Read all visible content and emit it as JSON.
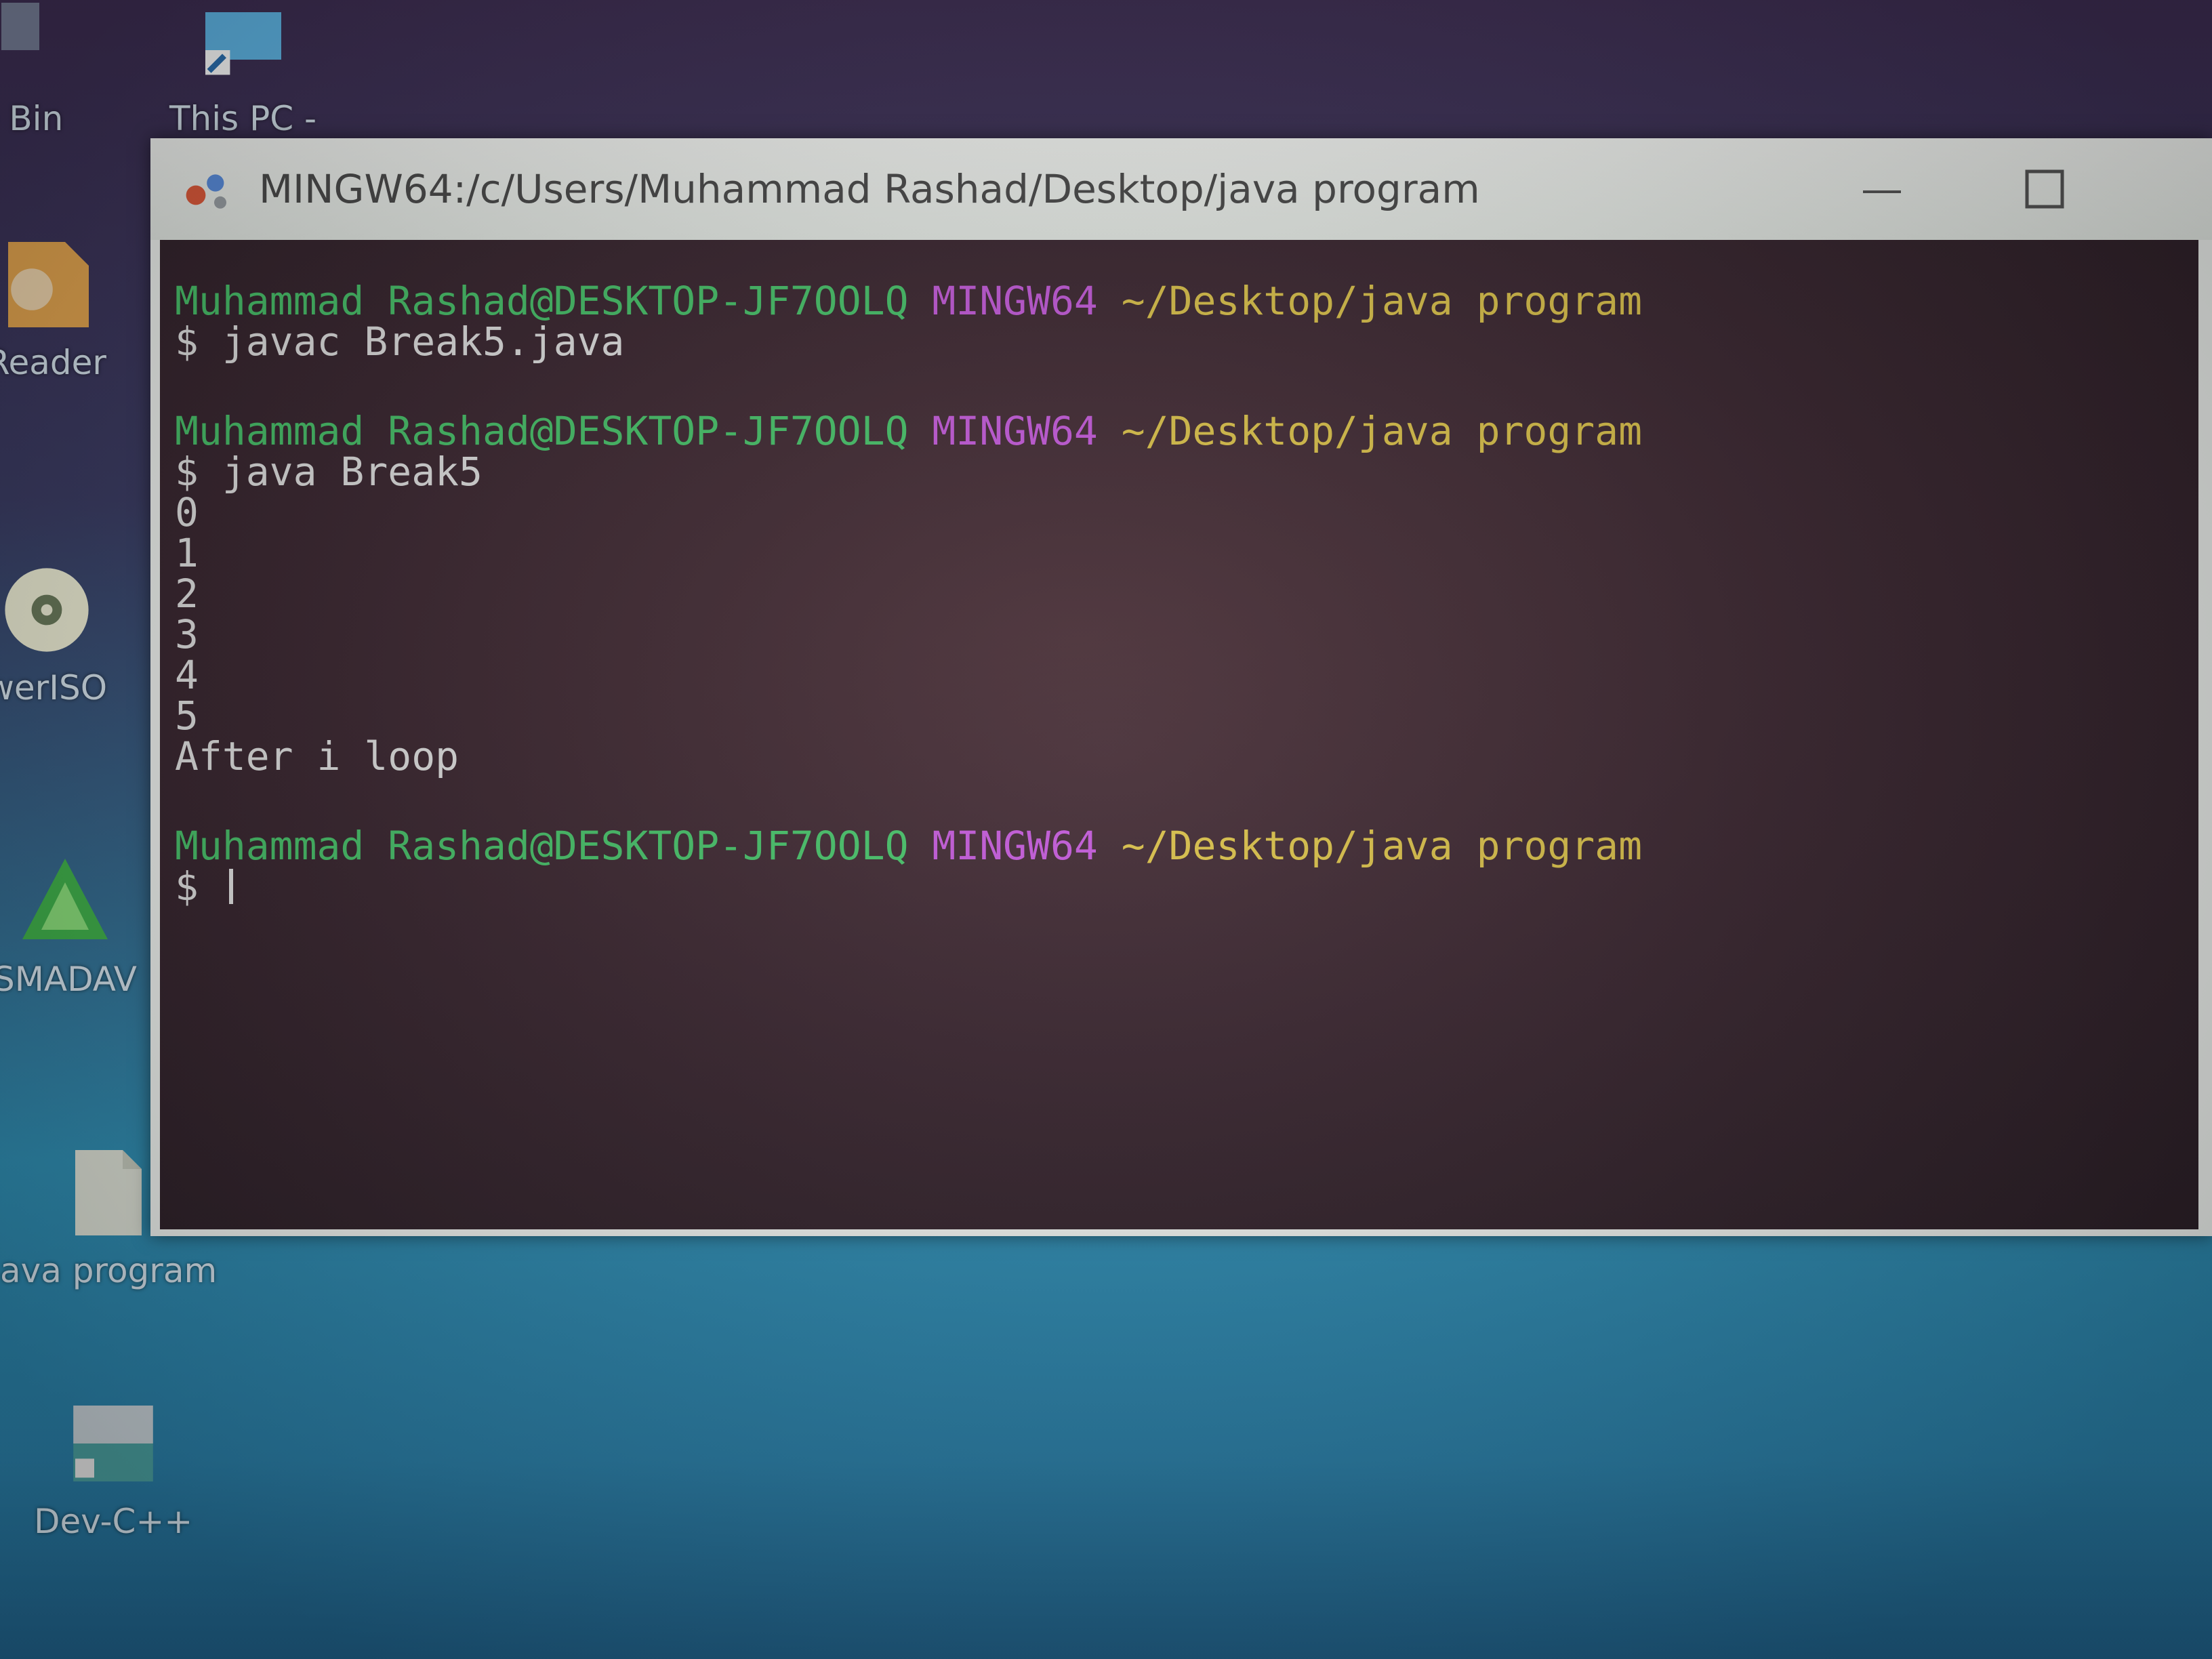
{
  "desktop": {
    "icons": [
      {
        "label": "e Bin",
        "icon": "recycle-bin-icon"
      },
      {
        "label": "This PC -",
        "icon": "this-pc-icon"
      },
      {
        "label": "Reader",
        "icon": "pdf-reader-icon"
      },
      {
        "label": "werISO",
        "icon": "poweriso-icon"
      },
      {
        "label": "SMADAV",
        "icon": "smadav-icon"
      },
      {
        "label": "ava program",
        "icon": "folder-icon"
      },
      {
        "label": "Dev-C++",
        "icon": "dev-cpp-icon"
      }
    ]
  },
  "window": {
    "title": "MINGW64:/c/Users/Muhammad Rashad/Desktop/java program",
    "app_icon": "git-bash-icon",
    "minimize_icon": "minimize-icon",
    "maximize_icon": "maximize-icon"
  },
  "terminal": {
    "prompt_user": "Muhammad Rashad@DESKTOP-JF7OOLQ",
    "prompt_system": "MINGW64",
    "prompt_path": "~/Desktop/java program",
    "cmd1": "$ javac Break5.java",
    "cmd2": "$ java Break5",
    "output": [
      "0",
      "1",
      "2",
      "3",
      "4",
      "5",
      "After i loop"
    ],
    "cmd3": "$ "
  },
  "colors": {
    "user": "#48c26a",
    "system": "#c25ad8",
    "path": "#d9c04a",
    "terminal_bg": "#3a2630"
  }
}
